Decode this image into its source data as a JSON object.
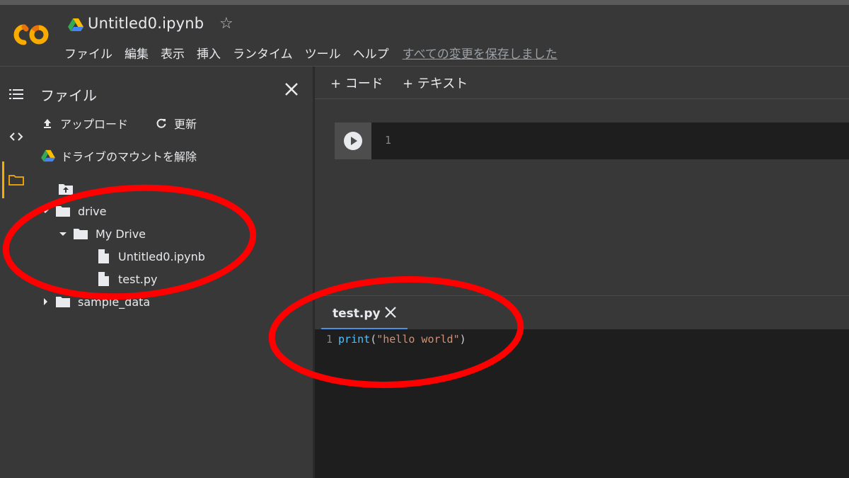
{
  "app": {
    "title": "Untitled0.ipynb",
    "saved_status": "すべての変更を保存しました",
    "accent_color": "#f9ab00",
    "logo": "colab-logo",
    "star_icon": "star-outline-icon"
  },
  "menu": [
    "ファイル",
    "編集",
    "表示",
    "挿入",
    "ランタイム",
    "ツール",
    "ヘルプ"
  ],
  "sidebar": {
    "title": "ファイル",
    "actions": {
      "upload": "アップロード",
      "refresh": "更新",
      "unmount": "ドライブのマウントを解除"
    },
    "tree": [
      {
        "label": "..",
        "type": "parent-folder"
      },
      {
        "label": "drive",
        "type": "folder",
        "expanded": true
      },
      {
        "label": "My Drive",
        "type": "folder",
        "expanded": true
      },
      {
        "label": "Untitled0.ipynb",
        "type": "file"
      },
      {
        "label": "test.py",
        "type": "file"
      },
      {
        "label": "sample_data",
        "type": "folder",
        "expanded": false
      }
    ]
  },
  "toolbar": {
    "code_label": "+ コード",
    "text_label": "+ テキスト"
  },
  "cell": {
    "line_number": "1"
  },
  "editor": {
    "tab_label": "test.py",
    "code": {
      "line_number": "1",
      "fn": "print",
      "open": "(",
      "string": "\"hello world\"",
      "close": ")"
    }
  },
  "annotation": {
    "color": "#ff0000"
  }
}
